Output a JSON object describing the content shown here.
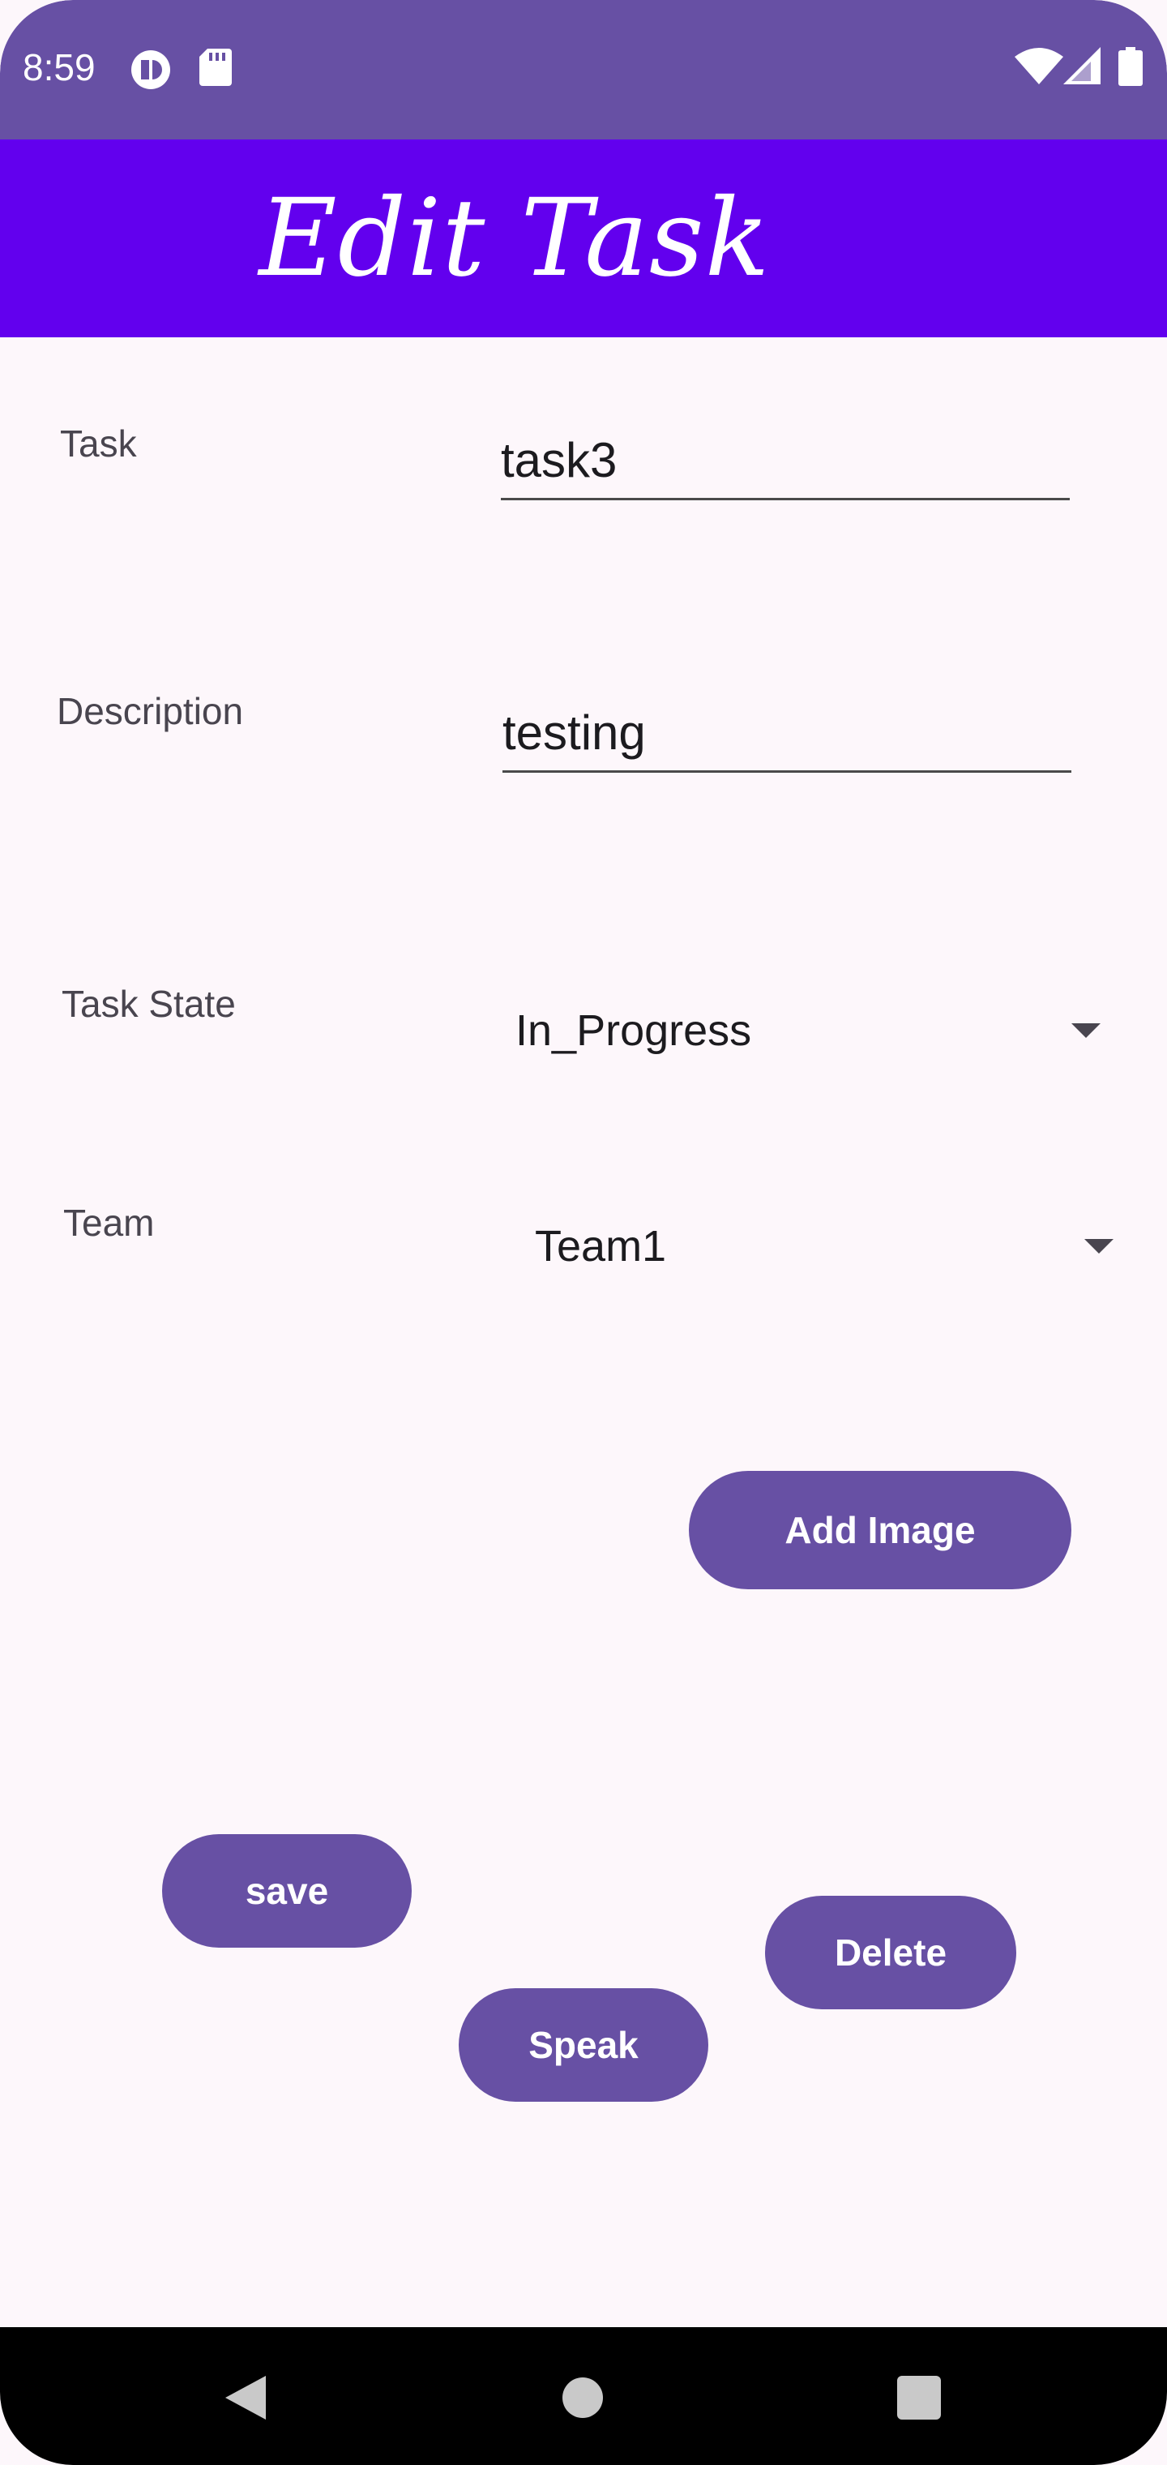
{
  "status_bar": {
    "time": "8:59",
    "icons_left": [
      "notification-badge-icon",
      "sd-card-icon"
    ],
    "icons_right": [
      "wifi-icon",
      "signal-icon",
      "battery-icon"
    ]
  },
  "app_bar": {
    "title": "Edit Task",
    "color": "#6200ee"
  },
  "form": {
    "task_label": "Task",
    "task_value": "task3",
    "description_label": "Description",
    "description_value": "testing",
    "task_state_label": "Task State",
    "task_state_value": "In_Progress",
    "team_label": "Team",
    "team_value": "Team1"
  },
  "buttons": {
    "add_image": "Add Image",
    "save": "save",
    "delete": "Delete",
    "speak": "Speak"
  },
  "colors": {
    "primary": "#6750a4",
    "app_bar": "#6200ee",
    "background": "#fdf7fb"
  }
}
